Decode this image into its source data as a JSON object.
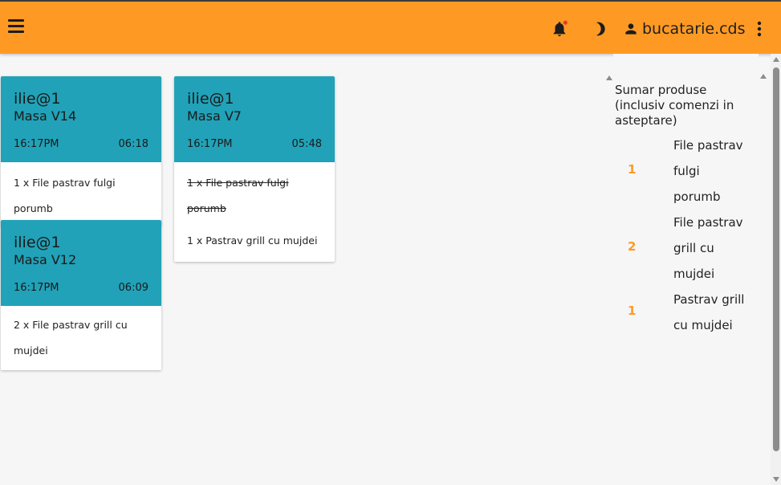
{
  "header": {
    "user_name": "bucatarie.cds",
    "accent_color": "#fe9a24",
    "notification_dot_color": "#e53935",
    "icons": [
      "menu-icon",
      "bell-icon",
      "dark-mode-icon",
      "person-icon",
      "more-vert-icon"
    ]
  },
  "orders": [
    {
      "user": "ilie@1",
      "table": "Masa V14",
      "time": "16:17PM",
      "timer": "06:18",
      "items": [
        "1 x File pastrav fulgi porumb"
      ]
    },
    {
      "user": "ilie@1",
      "table": "Masa V7",
      "time": "16:17PM",
      "timer": "05:48",
      "items": [
        "1 x File pastrav fulgi porumb",
        "1 x Pastrav grill cu mujdei"
      ]
    },
    {
      "user": "ilie@1",
      "table": "Masa V12",
      "time": "16:17PM",
      "timer": "06:09",
      "items": [
        "2 x File pastrav grill cu",
        "mujdei"
      ]
    }
  ],
  "summary": {
    "title": "Sumar produse (inclusiv comenzi in asteptare)",
    "rows": [
      {
        "qty": "1",
        "name": [
          "File pastrav",
          "fulgi",
          "porumb"
        ]
      },
      {
        "qty": "2",
        "name": [
          "File pastrav",
          "grill cu",
          "mujdei"
        ]
      },
      {
        "qty": "1",
        "name": [
          "Pastrav grill",
          "cu mujdei"
        ]
      }
    ]
  }
}
